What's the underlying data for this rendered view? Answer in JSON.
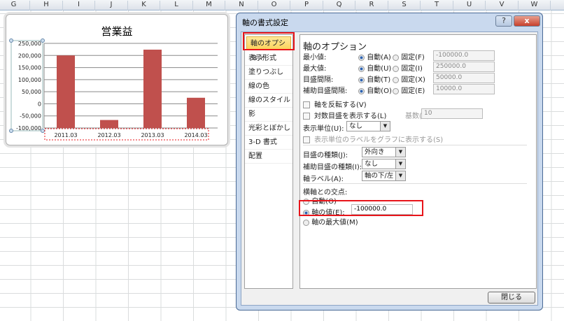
{
  "columns": [
    "G",
    "H",
    "I",
    "J",
    "K",
    "L",
    "M",
    "N",
    "O",
    "P",
    "Q",
    "R",
    "S",
    "T",
    "U",
    "V",
    "W"
  ],
  "chart_data": {
    "type": "bar",
    "title": "営業益",
    "categories": [
      "2011.03",
      "2012.03",
      "2013.03",
      "2014.03"
    ],
    "values": [
      200000,
      -67000,
      224000,
      25000
    ],
    "ylim": [
      -100000,
      250000
    ],
    "yticks": [
      "250,000",
      "200,000",
      "150,000",
      "100,000",
      "50,000",
      "0",
      "-50,000",
      "-100,000"
    ],
    "ytick_values": [
      250000,
      200000,
      150000,
      100000,
      50000,
      0,
      -50000,
      -100000
    ],
    "bar_color": "#c0504d",
    "grid": true,
    "crosses_at": -100000
  },
  "dialog": {
    "title": "軸の書式設定",
    "help": "?",
    "close_x": "x",
    "nav": [
      "軸のオプション",
      "表示形式",
      "塗りつぶし",
      "線の色",
      "線のスタイル",
      "影",
      "光彩とぼかし",
      "3-D 書式",
      "配置"
    ],
    "heading": "軸のオプション",
    "rows": [
      {
        "label": "最小値:",
        "auto": "自動(A)",
        "fixed": "固定(F)",
        "value": "-100000.0"
      },
      {
        "label": "最大値:",
        "auto": "自動(U)",
        "fixed": "固定(I)",
        "value": "250000.0"
      },
      {
        "label": "目盛間隔:",
        "auto": "自動(T)",
        "fixed": "固定(X)",
        "value": "50000.0"
      },
      {
        "label": "補助目盛間隔:",
        "auto": "自動(O)",
        "fixed": "固定(E)",
        "value": "10000.0"
      }
    ],
    "reverse": "軸を反転する(V)",
    "log": "対数目盛を表示する(L)",
    "base_label": "基数(B):",
    "base_value": "10",
    "unit_label": "表示単位(U):",
    "unit_value": "なし",
    "unit_show": "表示単位のラベルをグラフに表示する(S)",
    "tick_type_label": "目盛の種類(J):",
    "tick_type_value": "外向き",
    "minor_tick_label": "補助目盛の種類(I):",
    "minor_tick_value": "なし",
    "axis_label_label": "軸ラベル(A):",
    "axis_label_value": "軸の下/左",
    "cross_heading": "横軸との交点:",
    "cross_auto": "自動(O)",
    "cross_value_label": "軸の値(E):",
    "cross_value": "-100000.0",
    "cross_max": "軸の最大値(M)",
    "close": "閉じる"
  }
}
